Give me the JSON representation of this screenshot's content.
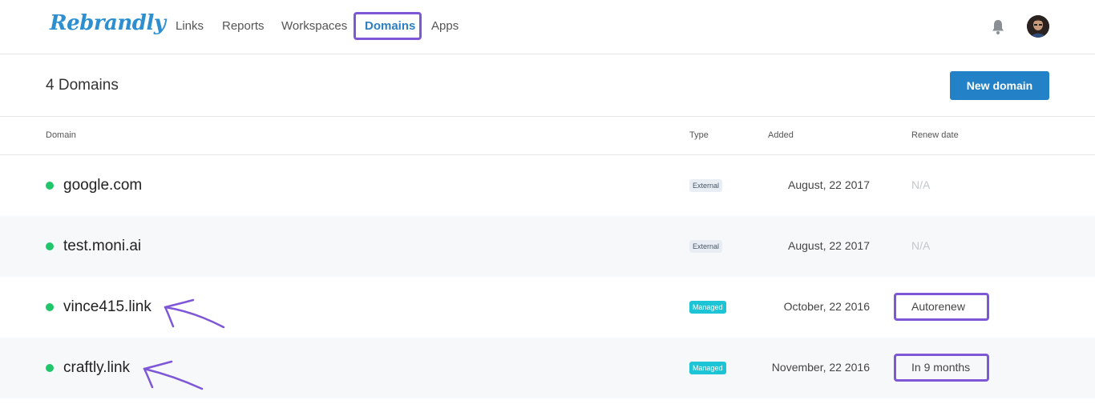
{
  "app": {
    "logo_text": "Rebrandly"
  },
  "nav": {
    "items": [
      {
        "label": "Links"
      },
      {
        "label": "Reports"
      },
      {
        "label": "Workspaces"
      },
      {
        "label": "Domains"
      },
      {
        "label": "Apps"
      }
    ],
    "active": "Domains"
  },
  "header": {
    "title": "4 Domains",
    "new_button_label": "New domain"
  },
  "table": {
    "columns": [
      "Domain",
      "Type",
      "Added",
      "Renew date"
    ],
    "rows": [
      {
        "domain": "google.com",
        "type": "External",
        "added": "August, 22 2017",
        "renew": "N/A",
        "status": "active"
      },
      {
        "domain": "test.moni.ai",
        "type": "External",
        "added": "August, 22 2017",
        "renew": "N/A",
        "status": "active"
      },
      {
        "domain": "vince415.link",
        "type": "Managed",
        "added": "October, 22 2016",
        "renew": "Autorenew",
        "status": "active"
      },
      {
        "domain": "craftly.link",
        "type": "Managed",
        "added": "November, 22 2016",
        "renew": "In 9 months",
        "status": "active"
      }
    ]
  },
  "colors": {
    "accent": "#2281c7",
    "annotation": "#7e57d6",
    "status_active": "#1fc66a",
    "managed_badge": "#1cc4d6"
  },
  "icons": {
    "notifications": "bell-icon",
    "user": "avatar"
  }
}
